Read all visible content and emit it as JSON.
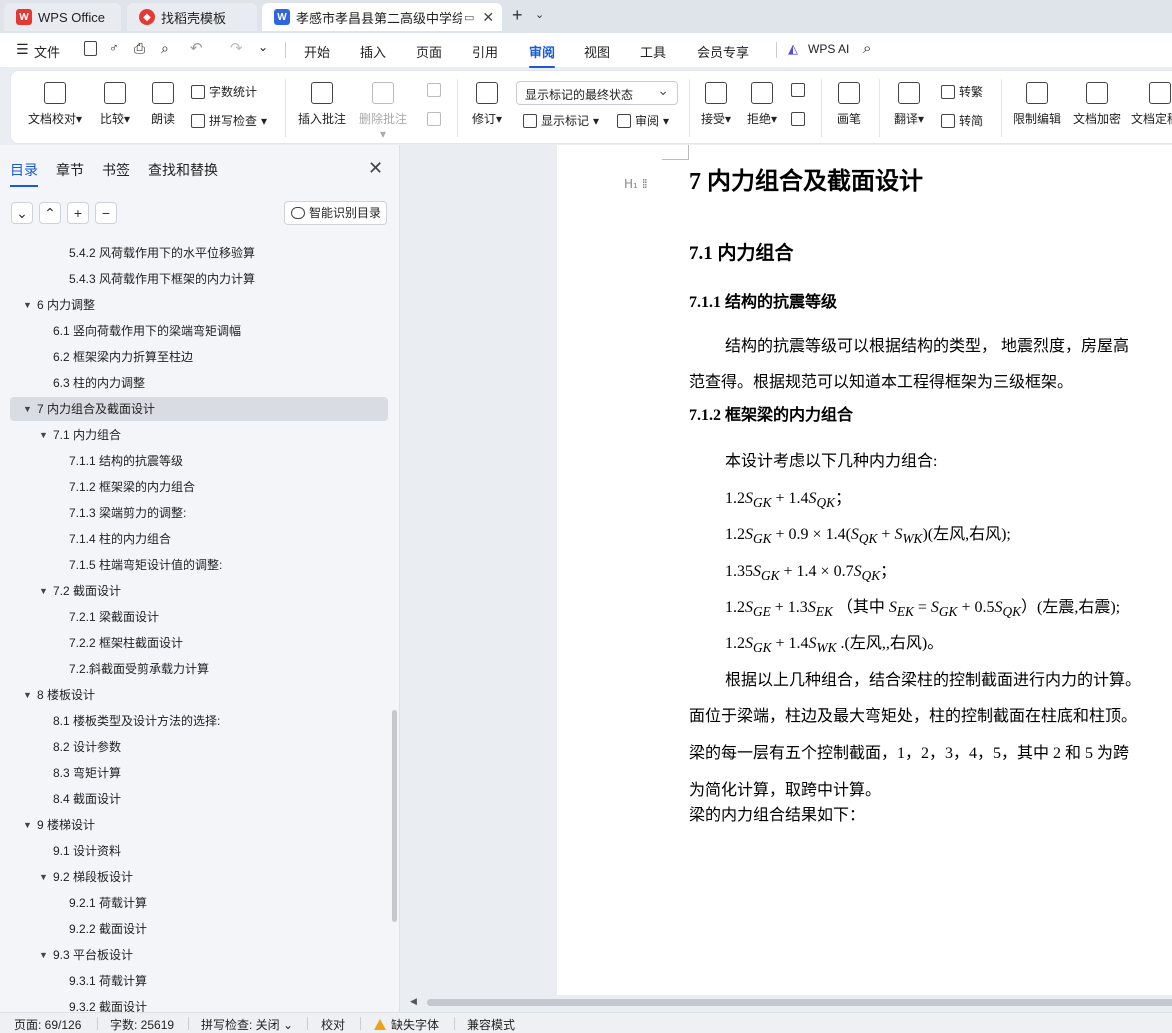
{
  "tabs": [
    {
      "label": "WPS Office",
      "icon": "wps-logo-icon",
      "color": "#e53935"
    },
    {
      "label": "找稻壳模板",
      "icon": "docer-icon",
      "color": "#e53935"
    },
    {
      "label": "孝感市孝昌县第二高级中学综合",
      "icon": "word-doc-icon",
      "color": "#2f66e0"
    }
  ],
  "file_menu": "文件",
  "menus": [
    "开始",
    "插入",
    "页面",
    "引用",
    "审阅",
    "视图",
    "工具",
    "会员专享"
  ],
  "active_menu": "审阅",
  "wps_ai": "WPS AI",
  "ribbon": {
    "doc_proof": "文档校对",
    "compare": "比较",
    "read_aloud": "朗读",
    "word_count": "字数统计",
    "spell_check": "拼写检查",
    "insert_comment": "插入批注",
    "delete_comment": "删除批注",
    "revise": "修订",
    "markup_state": "显示标记的最终状态",
    "show_markup": "显示标记",
    "review_pane": "审阅",
    "accept": "接受",
    "reject": "拒绝",
    "pen": "画笔",
    "translate": "翻译",
    "to_traditional": "转繁",
    "to_simplified": "转简",
    "restrict_edit": "限制编辑",
    "doc_encrypt": "文档加密",
    "doc_final": "文档定稿"
  },
  "nav": {
    "tabs": [
      "目录",
      "章节",
      "书签",
      "查找和替换"
    ],
    "active_tab": "目录",
    "smart_btn": "智能识别目录",
    "toc": [
      {
        "text": "5.4.2 风荷载作用下的水平位移验算",
        "level": 3,
        "arrow": false
      },
      {
        "text": "5.4.3 风荷载作用下框架的内力计算",
        "level": 3,
        "arrow": false
      },
      {
        "text": "6  内力调整",
        "level": 1,
        "arrow": true
      },
      {
        "text": "6.1 竖向荷载作用下的梁端弯矩调幅",
        "level": 2,
        "arrow": false
      },
      {
        "text": "6.2 框架梁内力折算至柱边",
        "level": 2,
        "arrow": false
      },
      {
        "text": "6.3 柱的内力调整",
        "level": 2,
        "arrow": false
      },
      {
        "text": "7  内力组合及截面设计",
        "level": 1,
        "arrow": true,
        "selected": true
      },
      {
        "text": "7.1 内力组合",
        "level": 2,
        "arrow": true
      },
      {
        "text": "7.1.1 结构的抗震等级",
        "level": 3,
        "arrow": false
      },
      {
        "text": "7.1.2 框架梁的内力组合",
        "level": 3,
        "arrow": false
      },
      {
        "text": "7.1.3 梁端剪力的调整:",
        "level": 3,
        "arrow": false
      },
      {
        "text": "7.1.4 柱的内力组合",
        "level": 3,
        "arrow": false
      },
      {
        "text": "7.1.5 柱端弯矩设计值的调整:",
        "level": 3,
        "arrow": false
      },
      {
        "text": "7.2 截面设计",
        "level": 2,
        "arrow": true
      },
      {
        "text": "7.2.1 梁截面设计",
        "level": 3,
        "arrow": false
      },
      {
        "text": "7.2.2 框架柱截面设计",
        "level": 3,
        "arrow": false
      },
      {
        "text": "7.2.斜截面受剪承载力计算",
        "level": 3,
        "arrow": false
      },
      {
        "text": "8  楼板设计",
        "level": 1,
        "arrow": true
      },
      {
        "text": "8.1 楼板类型及设计方法的选择:",
        "level": 2,
        "arrow": false
      },
      {
        "text": "8.2 设计参数",
        "level": 2,
        "arrow": false
      },
      {
        "text": "8.3 弯矩计算",
        "level": 2,
        "arrow": false
      },
      {
        "text": "8.4 截面设计",
        "level": 2,
        "arrow": false
      },
      {
        "text": "9  楼梯设计",
        "level": 1,
        "arrow": true
      },
      {
        "text": "9.1 设计资料",
        "level": 2,
        "arrow": false
      },
      {
        "text": "9.2 梯段板设计",
        "level": 2,
        "arrow": true
      },
      {
        "text": "9.2.1 荷载计算",
        "level": 3,
        "arrow": false
      },
      {
        "text": "9.2.2 截面设计",
        "level": 3,
        "arrow": false
      },
      {
        "text": "9.3 平台板设计",
        "level": 2,
        "arrow": true
      },
      {
        "text": "9.3.1 荷载计算",
        "level": 3,
        "arrow": false
      },
      {
        "text": "9.3.2 截面设计",
        "level": 3,
        "arrow": false
      }
    ]
  },
  "doc": {
    "heading_mark": "H₁",
    "h1": "7  内力组合及截面设计",
    "h2": "7.1 内力组合",
    "h3a": "7.1.1 结构的抗震等级",
    "p1a": "结构的抗震等级可以根据结构的类型， 地震烈度，房屋高",
    "p1b": "范查得。根据规范可以知道本工程得框架为三级框架。",
    "h3b": "7.1.2 框架梁的内力组合",
    "p2": "本设计考虑以下几种内力组合:",
    "p3a": "根据以上几种组合，结合梁柱的控制截面进行内力的计算。",
    "p3b": "面位于梁端，柱边及最大弯矩处，柱的控制截面在柱底和柱顶。",
    "p3c": "梁的每一层有五个控制截面，1，2，3，4，5，其中 2 和 5 为跨",
    "p3d": "为简化计算，取跨中计算。",
    "p4": "梁的内力组合结果如下："
  },
  "status": {
    "page": "页面: 69/126",
    "words": "字数: 25619",
    "spell": "拼写检查: 关闭",
    "proof": "校对",
    "missing_font": "缺失字体",
    "compat": "兼容模式"
  }
}
